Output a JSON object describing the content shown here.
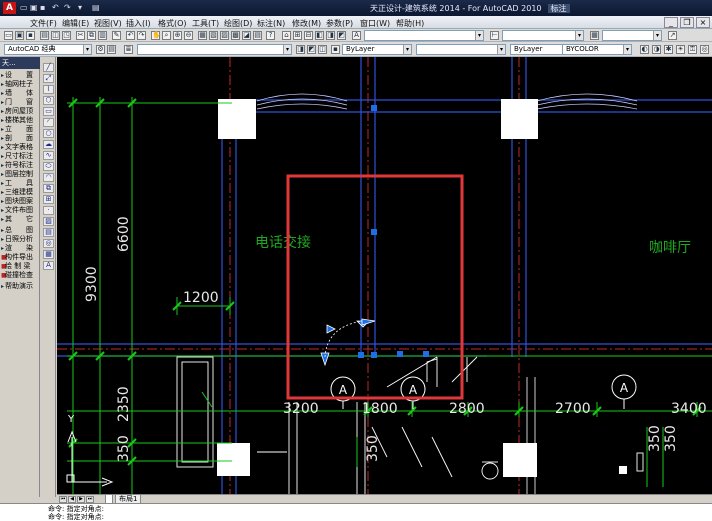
{
  "window": {
    "title": "天正设计-建筑系统 2014 - For AutoCAD 2010",
    "title_tag": "标注",
    "app_icon": "A"
  },
  "menubar": {
    "items": [
      "文件(F)",
      "编辑(E)",
      "视图(V)",
      "插入(I)",
      "格式(O)",
      "工具(T)",
      "绘图(D)",
      "标注(N)",
      "修改(M)",
      "参数(P)",
      "窗口(W)",
      "帮助(H)"
    ]
  },
  "toolbar2": {
    "workspace": "AutoCAD 经典"
  },
  "toolbar3": {
    "layer_color": "ByLayer",
    "linetype": "ByLayer",
    "lineweight": "ByLayer",
    "plotstyle": "BYCOLOR"
  },
  "leftpanel": {
    "header": "天...",
    "items": [
      "设　　置",
      "轴网柱子",
      "墙　　体",
      "门　　窗",
      "房间屋顶",
      "楼梯其他",
      "立　　面",
      "剖　　面",
      "文字表格",
      "尺寸标注",
      "符号标注",
      "图层控制",
      "工　　具",
      "三维建模",
      "图块图案",
      "文件布图",
      "其　　它",
      "总　　图",
      "日照分析",
      "渲　　染",
      "构件导出",
      "绘 制 梁",
      "碰撞检查",
      "帮助演示"
    ]
  },
  "drawing": {
    "room_label_left": "电话交接",
    "room_label_right": "咖啡厅",
    "dims_bottom": [
      "3200",
      "1800",
      "2800",
      "2700",
      "3400"
    ],
    "dim_1200": "1200",
    "dims_left_vertical": [
      "6600",
      "9300",
      "2350",
      "350"
    ],
    "dim_350_mid": "350",
    "dims_right_vertical": [
      "350",
      "350"
    ],
    "axis_bubble_label": "A",
    "ucs_y_label": "Y"
  },
  "tabs": {
    "items": [
      "布局1"
    ]
  },
  "cmdline": {
    "lines": [
      "命令: 指定对角点:",
      "命令: 指定对角点:"
    ]
  },
  "colors": {
    "canvas_bg": "#000000",
    "highlight_box": "#e0383a",
    "wall_blue": "#2f52d6",
    "dim_green": "#19c819",
    "grip_blue": "#1e6ee8"
  }
}
